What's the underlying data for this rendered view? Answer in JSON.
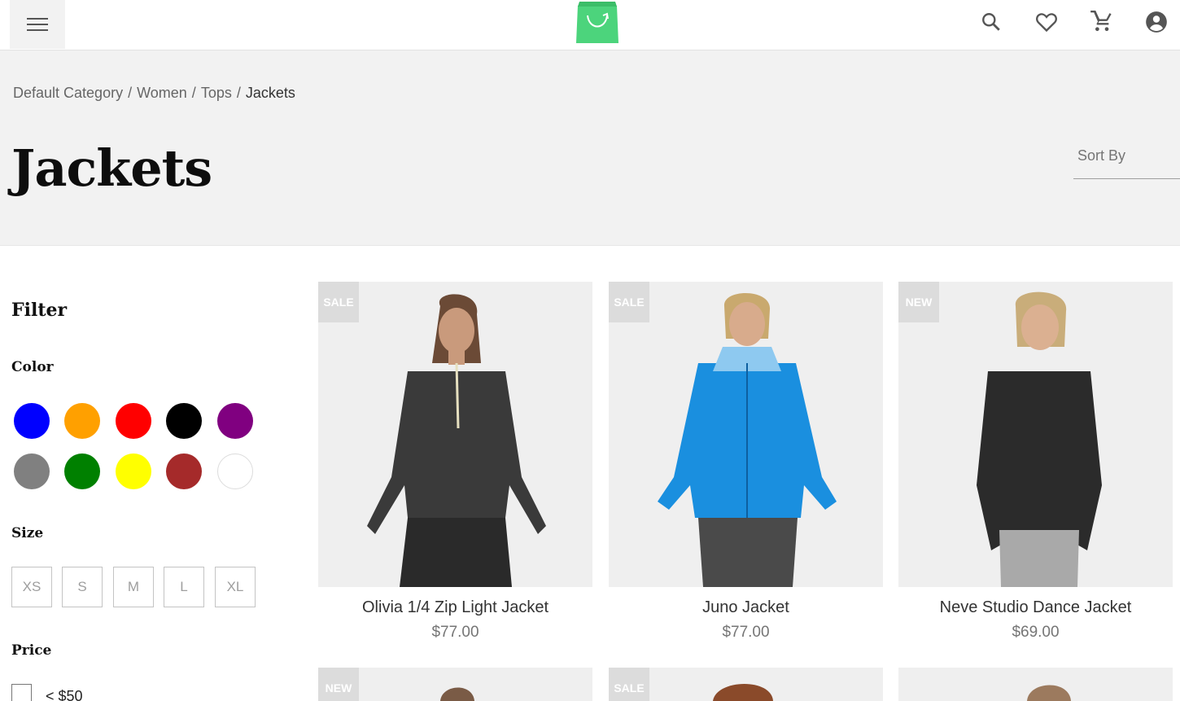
{
  "header": {
    "menu_icon": "hamburger-menu-icon",
    "logo_icon": "shopping-bag-logo",
    "icons": [
      "search-icon",
      "heart-icon",
      "cart-icon",
      "account-icon"
    ],
    "brand_color": "#4cd47c"
  },
  "breadcrumb": {
    "items": [
      "Default Category",
      "Women",
      "Tops"
    ],
    "current": "Jackets",
    "separator": "/"
  },
  "page": {
    "title": "Jackets",
    "sort_placeholder": "Sort By"
  },
  "filter": {
    "title": "Filter",
    "color": {
      "label": "Color",
      "swatches": [
        "#0000ff",
        "#ffa000",
        "#ff0000",
        "#000000",
        "#800080",
        "#808080",
        "#008000",
        "#ffff00",
        "#a52a2a",
        "#ffffff"
      ]
    },
    "size": {
      "label": "Size",
      "options": [
        "XS",
        "S",
        "M",
        "L",
        "XL"
      ]
    },
    "price": {
      "label": "Price",
      "options": [
        "< $50"
      ]
    }
  },
  "products": [
    {
      "badge": "SALE",
      "name": "Olivia 1/4 Zip Light Jacket",
      "price": "$77.00",
      "color": "#3a3a3a"
    },
    {
      "badge": "SALE",
      "name": "Juno Jacket",
      "price": "$77.00",
      "color": "#1a8fdf"
    },
    {
      "badge": "NEW",
      "name": "Neve Studio Dance Jacket",
      "price": "$69.00",
      "color": "#2b2b2b"
    },
    {
      "badge": "NEW"
    },
    {
      "badge": "SALE"
    },
    {
      "badge": ""
    }
  ]
}
